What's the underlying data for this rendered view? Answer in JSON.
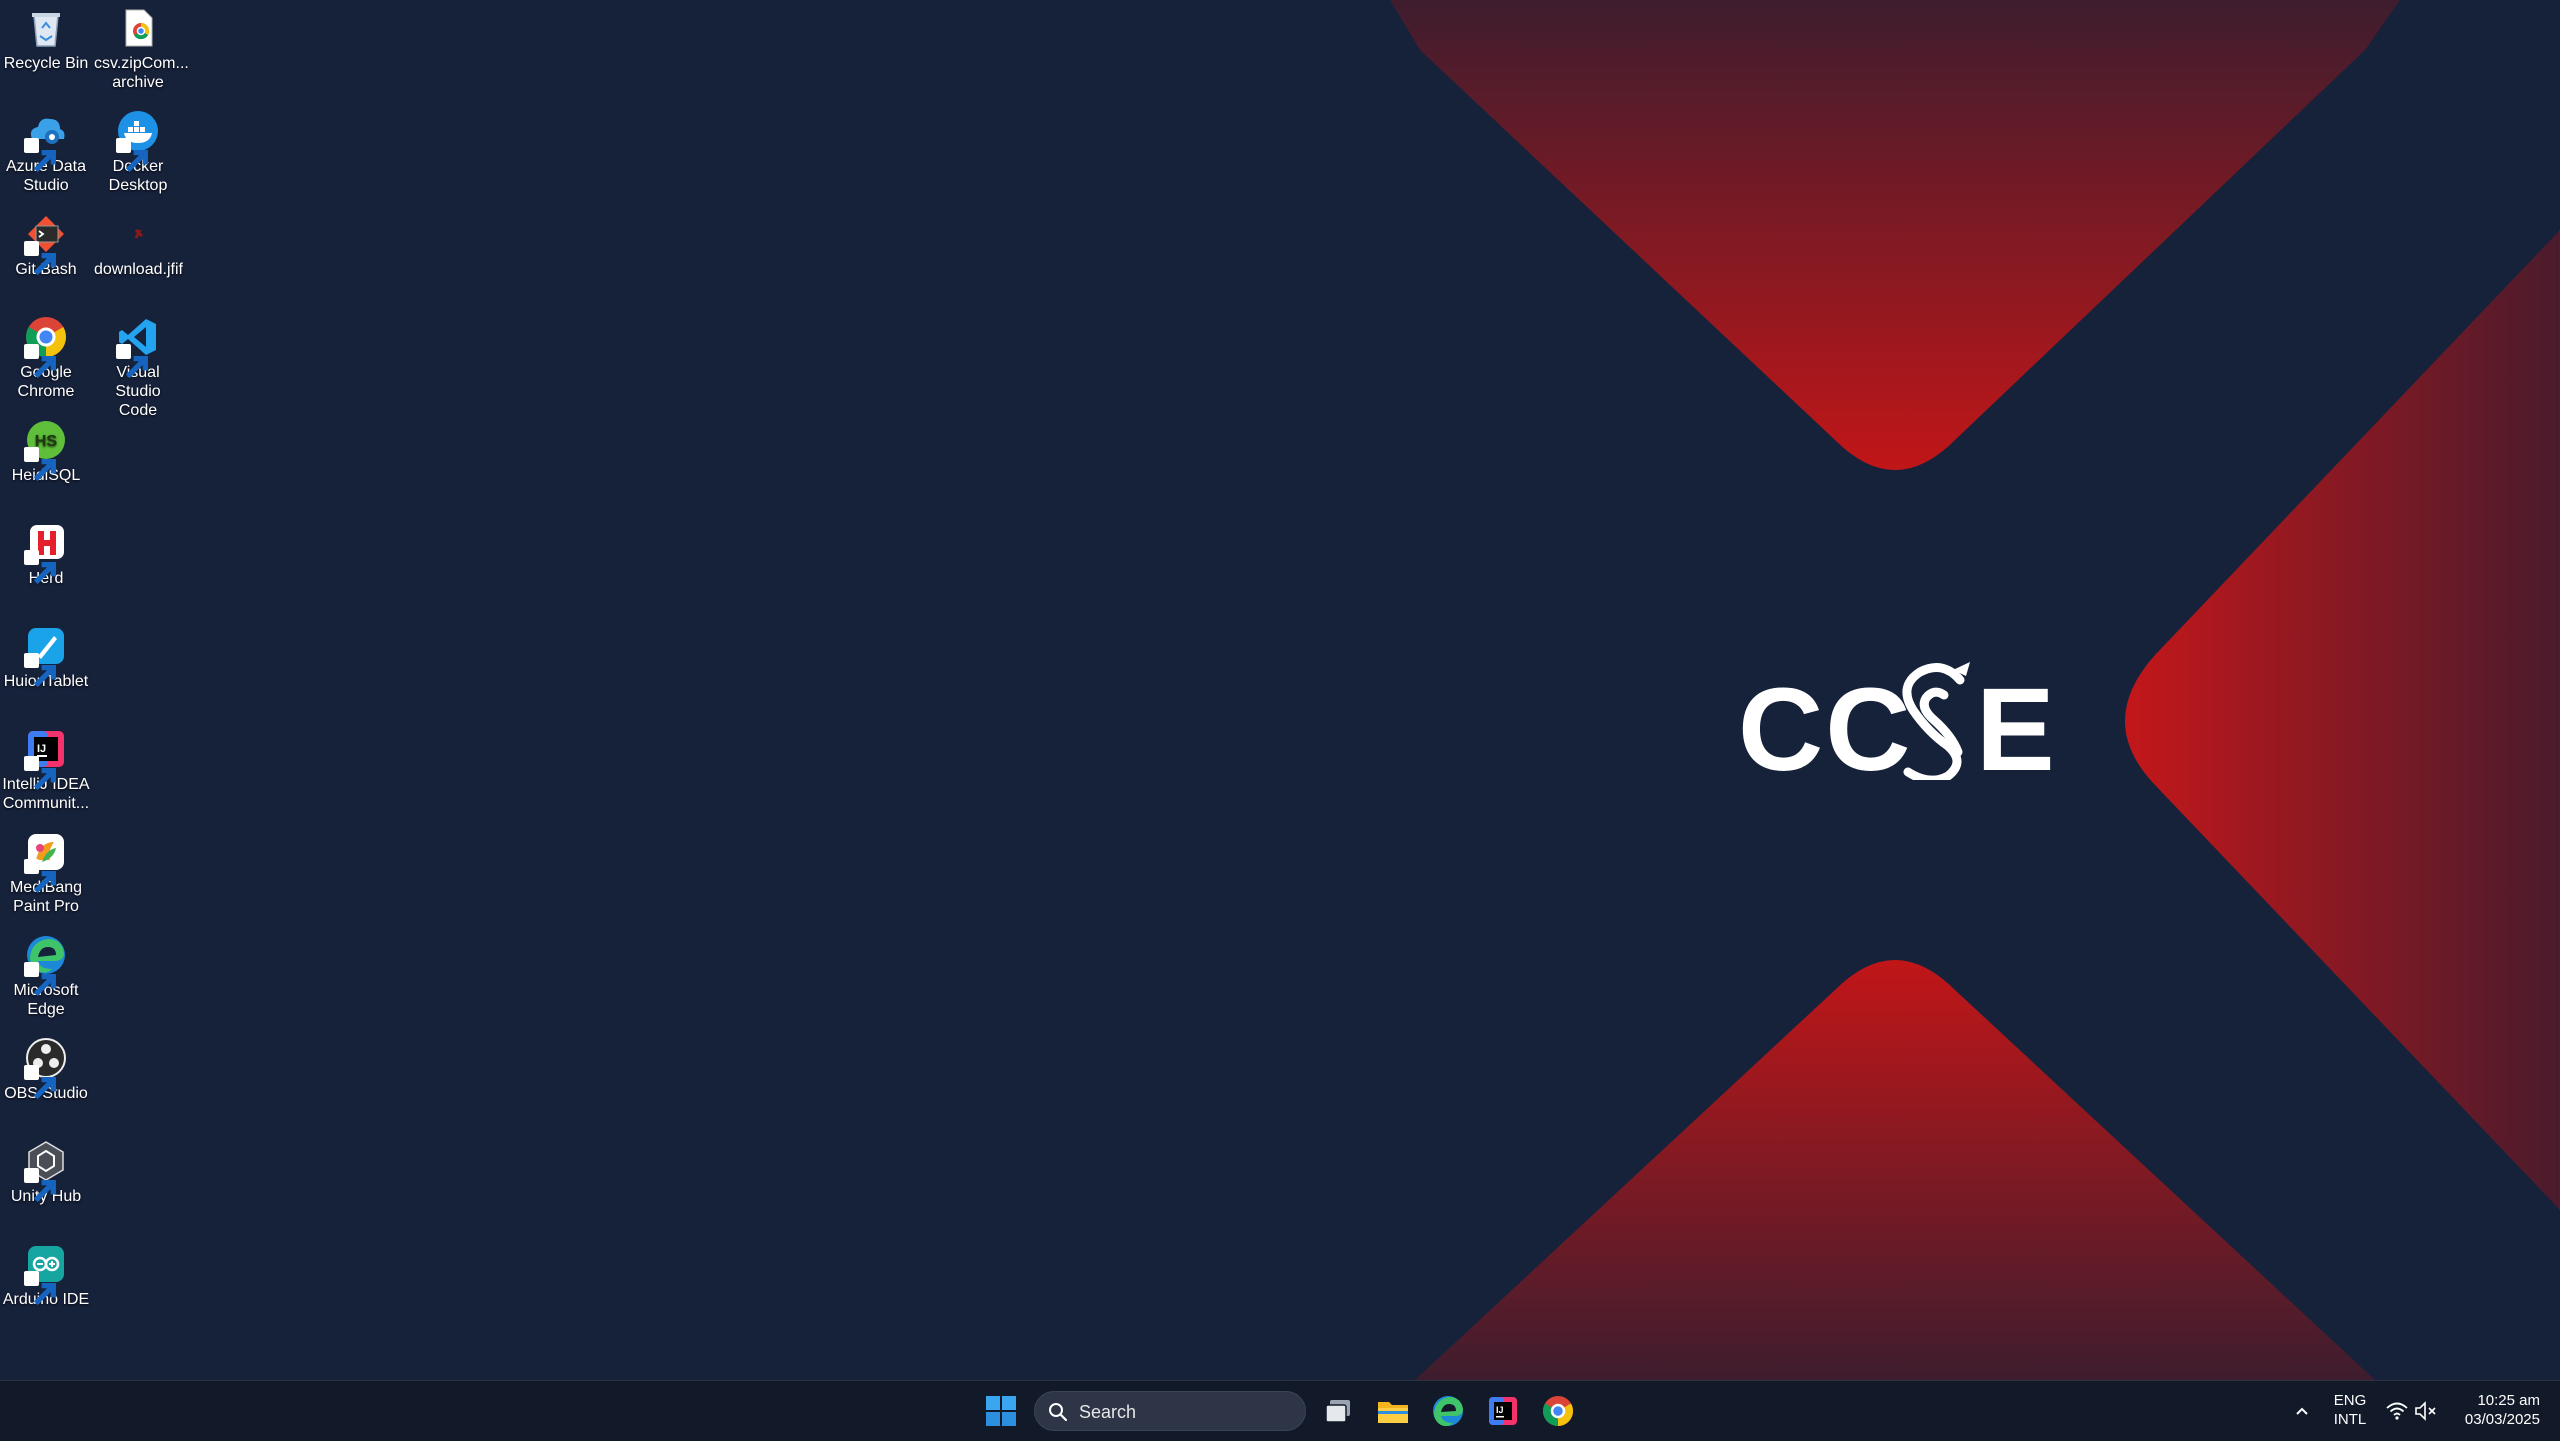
{
  "desktop": {
    "logo_text": "CCSE",
    "icons": [
      {
        "label": "Recycle Bin",
        "icon": "recycle-bin-icon"
      },
      {
        "label": "csv.zipCom... archive",
        "icon": "zip-archive-icon"
      },
      {
        "label": "Azure Data Studio",
        "icon": "azure-data-studio-icon"
      },
      {
        "label": "Docker Desktop",
        "icon": "docker-icon"
      },
      {
        "label": "Git Bash",
        "icon": "git-bash-icon"
      },
      {
        "label": "download.jfif",
        "icon": "image-file-icon"
      },
      {
        "label": "Google Chrome",
        "icon": "chrome-icon"
      },
      {
        "label": "Visual Studio Code",
        "icon": "vscode-icon"
      },
      {
        "label": "HeidiSQL",
        "icon": "heidisql-icon"
      },
      {
        "label": "Herd",
        "icon": "herd-icon"
      },
      {
        "label": "HuionTablet",
        "icon": "huion-tablet-icon"
      },
      {
        "label": "IntelliJ IDEA Communit...",
        "icon": "intellij-icon"
      },
      {
        "label": "MediBang Paint Pro",
        "icon": "medibang-icon"
      },
      {
        "label": "Microsoft Edge",
        "icon": "edge-icon"
      },
      {
        "label": "OBS Studio",
        "icon": "obs-icon"
      },
      {
        "label": "Unity Hub",
        "icon": "unity-hub-icon"
      },
      {
        "label": "Arduino IDE",
        "icon": "arduino-icon"
      }
    ]
  },
  "taskbar": {
    "search_placeholder": "Search",
    "pinned": [
      "start-icon",
      "task-view-icon",
      "file-explorer-icon",
      "edge-icon",
      "intellij-icon",
      "chrome-icon"
    ],
    "tray": {
      "language_line1": "ENG",
      "language_line2": "INTL",
      "time": "10:25 am",
      "date": "03/03/2025"
    }
  },
  "colors": {
    "background": "#16213a",
    "accent_red": "#c0161a",
    "taskbar": "#121a2a"
  }
}
